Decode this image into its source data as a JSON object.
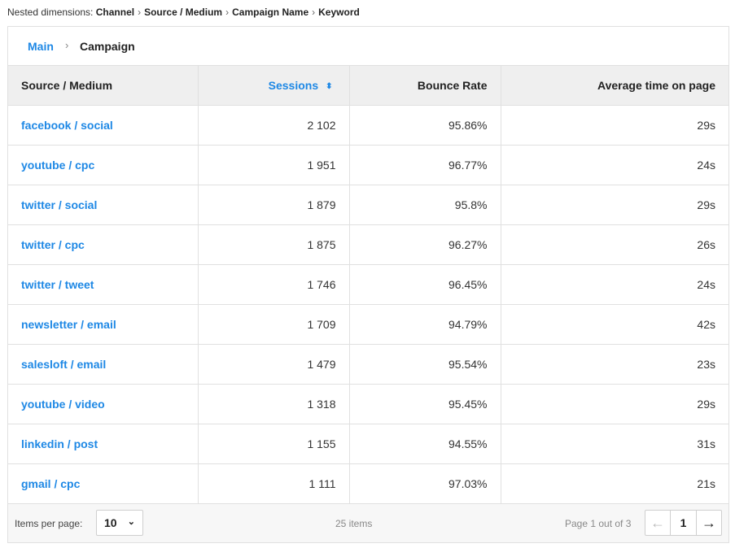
{
  "nested": {
    "label": "Nested dimensions:",
    "dims": [
      "Channel",
      "Source / Medium",
      "Campaign Name",
      "Keyword"
    ]
  },
  "breadcrumb": {
    "main": "Main",
    "current": "Campaign"
  },
  "table": {
    "headers": {
      "source": "Source / Medium",
      "sessions": "Sessions",
      "bounce": "Bounce Rate",
      "avgtime": "Average time on page"
    },
    "rows": [
      {
        "source": "facebook / social",
        "sessions": "2 102",
        "bounce": "95.86%",
        "avgtime": "29s"
      },
      {
        "source": "youtube / cpc",
        "sessions": "1 951",
        "bounce": "96.77%",
        "avgtime": "24s"
      },
      {
        "source": "twitter / social",
        "sessions": "1 879",
        "bounce": "95.8%",
        "avgtime": "29s"
      },
      {
        "source": "twitter / cpc",
        "sessions": "1 875",
        "bounce": "96.27%",
        "avgtime": "26s"
      },
      {
        "source": "twitter / tweet",
        "sessions": "1 746",
        "bounce": "96.45%",
        "avgtime": "24s"
      },
      {
        "source": "newsletter / email",
        "sessions": "1 709",
        "bounce": "94.79%",
        "avgtime": "42s"
      },
      {
        "source": "salesloft / email",
        "sessions": "1 479",
        "bounce": "95.54%",
        "avgtime": "23s"
      },
      {
        "source": "youtube / video",
        "sessions": "1 318",
        "bounce": "95.45%",
        "avgtime": "29s"
      },
      {
        "source": "linkedin / post",
        "sessions": "1 155",
        "bounce": "94.55%",
        "avgtime": "31s"
      },
      {
        "source": "gmail / cpc",
        "sessions": "1 111",
        "bounce": "97.03%",
        "avgtime": "21s"
      }
    ]
  },
  "footer": {
    "items_per_page_label": "Items per page:",
    "items_per_page_value": "10",
    "items_count": "25 items",
    "page_info": "Page 1 out of 3",
    "current_page": "1"
  },
  "colors": {
    "accent": "#1e88e5",
    "header_bg": "#efefef",
    "border": "#e0e0e0"
  }
}
